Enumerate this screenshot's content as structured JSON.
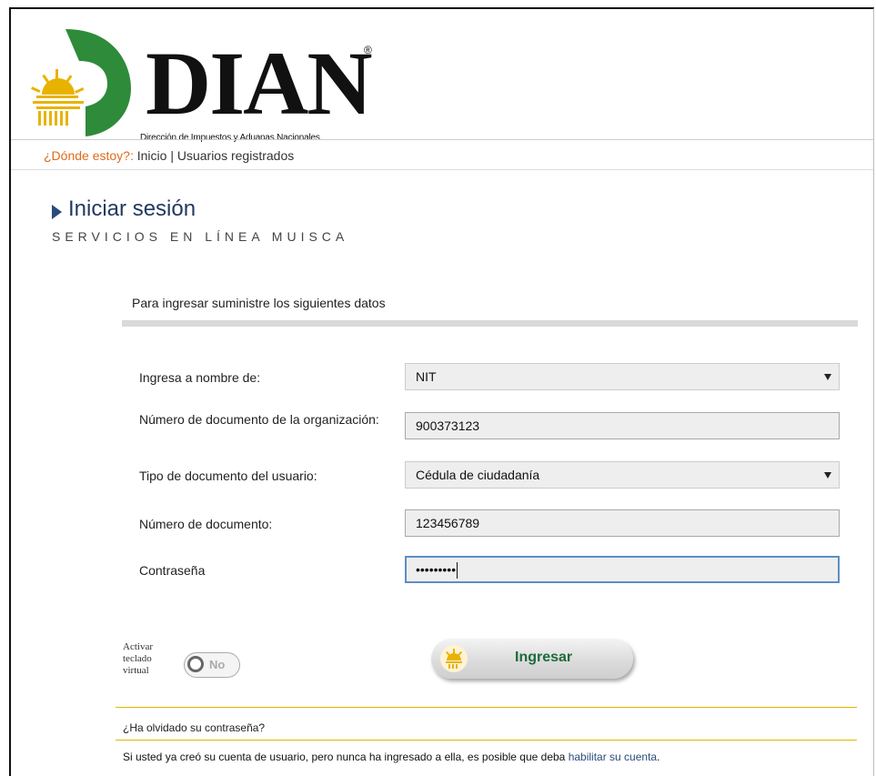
{
  "header": {
    "logo_text": "DIAN",
    "logo_reg": "®",
    "logo_subtitle": "Dirección de Impuestos y Aduanas Nacionales",
    "colors": {
      "green": "#2e8b3a",
      "yellow": "#e8b300"
    }
  },
  "breadcrumb": {
    "prefix": "¿Dónde estoy?:",
    "home": "Inicio",
    "separator": "|",
    "current": "Usuarios registrados"
  },
  "page": {
    "title": "Iniciar sesión",
    "subtitle": "SERVICIOS EN LÍNEA MUISCA"
  },
  "form": {
    "intro": "Para ingresar suministre los siguientes datos",
    "fields": [
      {
        "label": "Ingresa a nombre de:",
        "value": "NIT",
        "type": "select"
      },
      {
        "label": "Número de documento de la organización:",
        "value": "900373123",
        "type": "text"
      },
      {
        "label": "Tipo de documento del usuario:",
        "value": "Cédula de ciudadanía",
        "type": "select"
      },
      {
        "label": "Número de documento:",
        "value": "123456789",
        "type": "text"
      },
      {
        "label": "Contraseña",
        "value": "•••••••••",
        "type": "password",
        "focused": true
      }
    ]
  },
  "virtual_keyboard": {
    "label_line1": "Activar",
    "label_line2": "teclado",
    "label_line3": "virtual",
    "toggle_state": "No"
  },
  "submit": {
    "label": "Ingresar"
  },
  "footer": {
    "forgot_password": "¿Ha olvidado su contraseña?",
    "note_text": "Si usted ya creó su cuenta de usuario, pero nunca ha ingresado a ella, es posible que deba",
    "note_link": "habilitar su cuenta",
    "note_end": "."
  }
}
